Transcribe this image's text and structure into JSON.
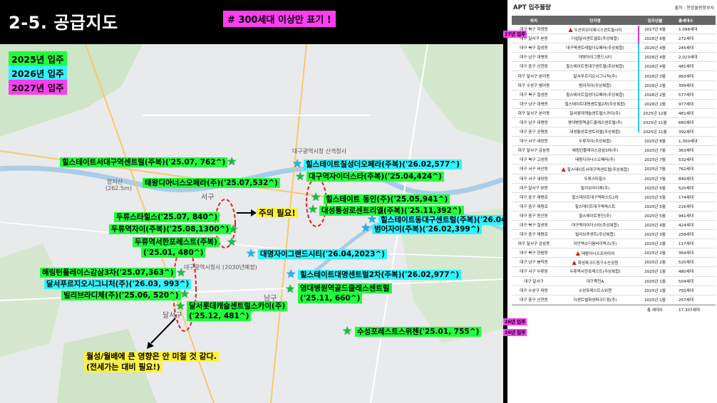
{
  "header": {
    "title": "2-5. 공급지도",
    "note": "# 300세대 이상만 표기 !"
  },
  "legend": {
    "y2025": "2025년 입주",
    "y2026": "2026년 입주",
    "y2027": "2027년 입주"
  },
  "colors": {
    "green": "#1fff3a",
    "cyan": "#2df5ff",
    "magenta": "#ff3df2",
    "yellow": "#fff23a"
  },
  "map": {
    "places": {
      "city_hall": "대구광역시청\n산격청사",
      "district_hall": "대구광역시청사\n(2030년예정)",
      "seogu": "서구",
      "namgu": "남구",
      "mountain": "함지산",
      "peak": "(262.5m)",
      "museum": "대구월드컵경기장",
      "dalseo": "달서구"
    },
    "labels": {
      "l1": "힐스테이트서대구역센트럴(주복)('25.07, 762^)",
      "l2": "힐스테이트칠성더오페라(주복)('26.02,577^)",
      "l3": "태왕디아너스오페라(주)('25.07,532^)",
      "l4": "대구역자이더스타(주복)('25.04,424^)",
      "l5": "힐스테이트 동인(주)('25.05,941^)",
      "l6": "대성통성로센트리엘(주복)('25.11,392^)",
      "l7": "힐스테이트동대구센트럴(주복)('26.04,481^)",
      "l8": "범어자이(주복)('26.02,399^)",
      "l9": "두류스타힐스('25.07, 840^)",
      "l10": "두류역자이(주복)('25.08,1300^)",
      "l11": "두류역서한포레스트(주복)",
      "l11b": "('25.01, 480^)",
      "l12": "대명자이그랜드시티('26.04,2023^)",
      "l13": "해링턴플레이스감삼3차('25.07,363^)",
      "l14": "달서푸르지오시그니처(주)('26.03, 993^)",
      "l15": "빌리브라디체(주)('25.06, 520^)",
      "l16": "달서롯데캐슬센트럴스카이(주)",
      "l16b": "('25.12, 481^)",
      "l17": "힐스테이트대명센트럴2차(주복)('26.02,977^)",
      "l18": "영대병원역골드클래스센트럴",
      "l18b": "('25.11, 660^)",
      "l19": "수성포레스트스위첸('25.01, 755^)",
      "caution": "주의 필요!",
      "bottom1": "월성/월배에 큰 영향은 안 미칠 것 같다.",
      "bottom2": "(전세가는 대비 필요!)"
    }
  },
  "panel": {
    "title": "APT 입주물량",
    "source": "출처 : 분양물량정보사",
    "headers": [
      "위치",
      "단지명",
      "입주년월",
      "총세대수"
    ],
    "tags": {
      "y2027": "27년 입주",
      "y2026": "26년 입주"
    },
    "rows": [
      [
        "대구 북구 학정동",
        "두산위브더제니스센트럴시티",
        "2027년 6월",
        "1,098세대"
      ],
      [
        "대구 달서구 본동",
        "더샵달서센트엘로(주상복합)",
        "2026년 6월",
        "272세대"
      ],
      [
        "대구 북구 칠성동",
        "대구역센트레빌더오페라(주상복합)",
        "2026년 4월",
        "245세대"
      ],
      [
        "대구 남구 대명동",
        "대명자이그랜드시티",
        "2026년 4월",
        "2,023세대"
      ],
      [
        "대구 중구 신천동",
        "힐스테이트동대구센트럴(주상복합)",
        "2026년 4월",
        "481세대"
      ],
      [
        "대구 달서구 본리동",
        "달서푸르지오시그니처(주)",
        "2026년 3월",
        "993세대"
      ],
      [
        "대구 수성구 범어동",
        "범어자이(주상복합)",
        "2026년 2월",
        "399세대"
      ],
      [
        "대구 북구 칠성동",
        "힐스테이트칠성더오페라(주상복합)",
        "2026년 2월",
        "577세대"
      ],
      [
        "대구 남구 대명동",
        "힐스테이트대명센트럴2차(주상복합)",
        "2026년 2월",
        "977세대"
      ],
      [
        "대구 달서구 본리동",
        "달서롯데캐슬센트럴스카이(주)",
        "2025년 12월",
        "481세대"
      ],
      [
        "대구 남구 대명동",
        "영대병원역골드클래스센트럴(주)",
        "2025년 11월",
        "660세대"
      ],
      [
        "대구 중구 공평동",
        "대성통성로센트리엘(주상복합)",
        "2025년 11월",
        "392세대"
      ],
      [
        "대구 서구 내당동",
        "두류자이(주상복합)",
        "2025년 8월",
        "1,300세대"
      ],
      [
        "대구 달서구 감삼동",
        "해링턴플레이스감삼3차(주)",
        "2025년 7월",
        "363세대"
      ],
      [
        "대구 북구 고성동",
        "태왕디아너스오페라(주)",
        "2025년 7월",
        "532세대"
      ],
      [
        "대구 서구 비산동",
        "힐스테이트서대구역센트럴(주상복합)",
        "2025년 7월",
        "762세대"
      ],
      [
        "대구 서구 내당동",
        "두류스타힐스",
        "2025년 7월",
        "840세대"
      ],
      [
        "대구 달서구 본동",
        "빌리브라디체(주)",
        "2025년 6월",
        "520세대"
      ],
      [
        "대구 중구 태평로",
        "힐스테이트대구역퍼스트2차",
        "2025년 5월",
        "174세대"
      ],
      [
        "대구 중구 태평로",
        "힐스테이트대구역퍼스트",
        "2025년 5월",
        "216세대"
      ],
      [
        "대구 중구 동인동",
        "힐스테이트동인(주)",
        "2025년 5월",
        "941세대"
      ],
      [
        "대구 북구 칠성동",
        "대구역자이더스타(주상복합)",
        "2025년 4월",
        "424세대"
      ],
      [
        "대구 중구 태평로",
        "빌리브루센트(주상복합)",
        "2025년 3월",
        "258세대"
      ],
      [
        "대구 달서구 감삼동",
        "이안엑소디움바이렉스(주)",
        "2025년 2월",
        "117세대"
      ],
      [
        "대구 북구 관음동",
        "태왕아너스프리미어",
        "2025년 2월",
        "364세대"
      ],
      [
        "대구 남구 봉덕동",
        "화성파크드림구수산공원",
        "2025년 2월",
        "520세대"
      ],
      [
        "대구 서구 두류동",
        "두류역서한포레스트(주상복합)",
        "2025년 1월",
        "480세대"
      ],
      [
        "대구 달서구",
        "대구죽전A",
        "2025년 1월",
        "504세대"
      ],
      [
        "대구 수성구 파동",
        "수성포레스트스위첸",
        "2025년 1월",
        "755세대"
      ],
      [
        "대구 중구 신천동",
        "더센트럴화성파크드림(주)",
        "2025년 1월",
        "257세대"
      ]
    ],
    "total_label": "총 세대수",
    "total_value": "17,307세대"
  }
}
